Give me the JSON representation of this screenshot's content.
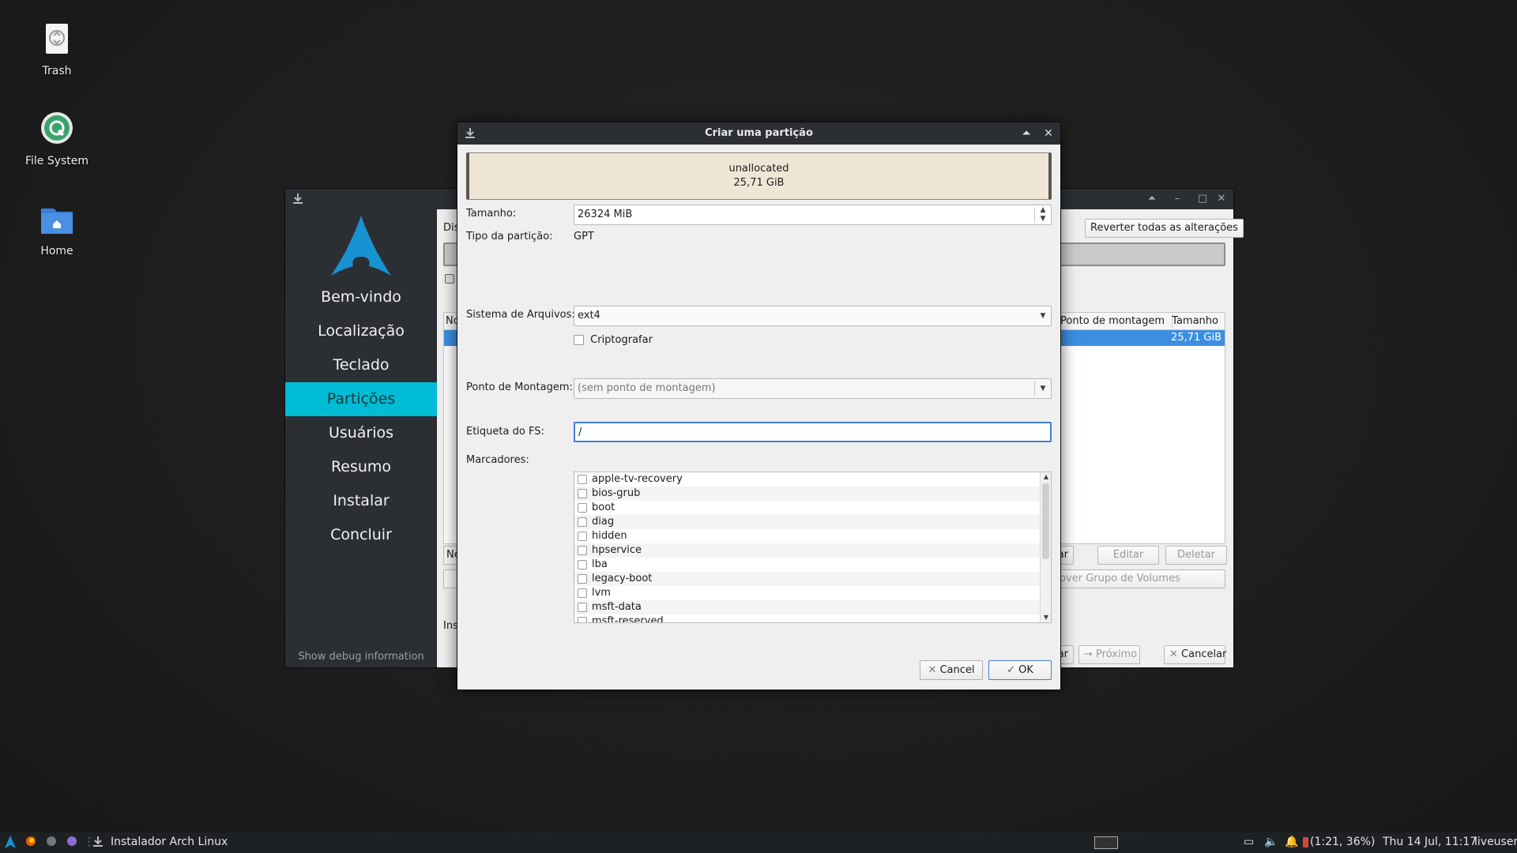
{
  "desktop": {
    "icons": [
      {
        "label": "Trash"
      },
      {
        "label": "File System"
      },
      {
        "label": "Home"
      }
    ]
  },
  "installer": {
    "sidebar": {
      "items": [
        "Bem-vindo",
        "Localização",
        "Teclado",
        "Partições",
        "Usuários",
        "Resumo",
        "Instalar",
        "Concluir"
      ],
      "active": "Partições",
      "debug_link": "Show debug information"
    },
    "fragments": {
      "dis": "Dis",
      "no": "No",
      "ne": "Ne",
      "ins": "Ins",
      "ar1": "ar",
      "ar2": "ar"
    },
    "revert_button": "Reverter todas as alterações",
    "table": {
      "col_mount": "Ponto de montagem",
      "col_size": "Tamanho",
      "selected_size": "25,71 GiB"
    },
    "buttons": {
      "edit": "Editar",
      "delete": "Deletar",
      "remove_vg": "Remover Grupo de Volumes",
      "next": "Próximo",
      "cancel": "Cancelar"
    }
  },
  "dialog": {
    "title": "Criar uma partição",
    "partition_bar": {
      "name": "unallocated",
      "size": "25,71 GiB"
    },
    "size_label": "Tamanho:",
    "size_value": "26324 MiB",
    "partition_type_label": "Tipo da partição:",
    "partition_type_value": "GPT",
    "filesystem_label": "Sistema de Arquivos:",
    "filesystem_value": "ext4",
    "encrypt_label": "Criptografar",
    "mount_label": "Ponto de Montagem:",
    "mount_placeholder": "(sem ponto de montagem)",
    "fs_label_label": "Etiqueta do FS:",
    "fs_label_value": "/",
    "flags_label": "Marcadores:",
    "flags": [
      "apple-tv-recovery",
      "bios-grub",
      "boot",
      "diag",
      "hidden",
      "hpservice",
      "lba",
      "legacy-boot",
      "lvm",
      "msft-data",
      "msft-reserved"
    ],
    "cancel_button": "Cancel",
    "ok_button": "OK"
  },
  "taskbar": {
    "app_label": "Instalador Arch Linux",
    "battery": "(1:21, 36%)",
    "datetime": "Thu 14 Jul, 11:17",
    "user": "liveuser"
  },
  "colors": {
    "accent": "#00bcd4",
    "selection": "#3d8ee0",
    "sidebar_bg": "#2b2f33",
    "partition_bar": "#f0e6d6"
  }
}
